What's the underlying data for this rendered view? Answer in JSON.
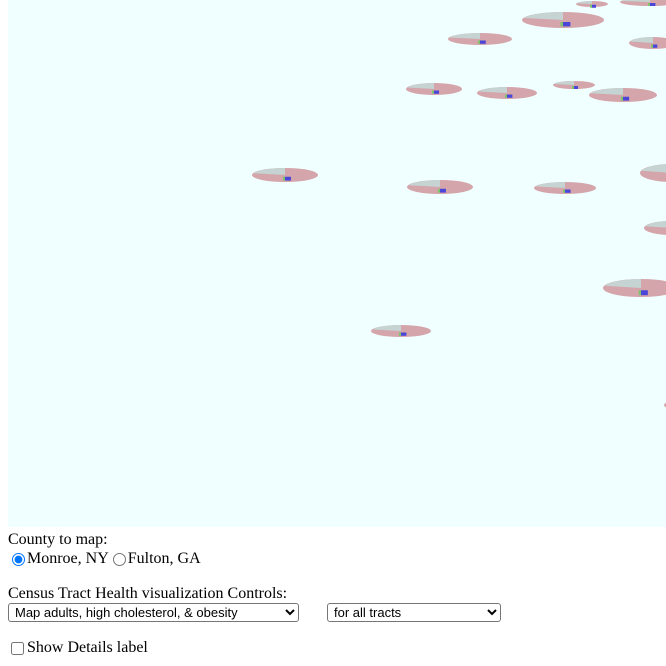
{
  "map": {
    "background": "#f0ffff",
    "glyph_colors": {
      "base": "#d4a5aa",
      "grey": "#c5d3d2",
      "blue": "#4b46d8",
      "green": "#7cc56b"
    },
    "glyph_icon": "pie-glyph"
  },
  "county": {
    "label": "County to map:",
    "options": [
      {
        "label": "Monroe, NY",
        "checked": true
      },
      {
        "label": "Fulton, GA",
        "checked": false
      }
    ]
  },
  "controls": {
    "label": "Census Tract Health visualization Controls:",
    "measure_selected": "Map adults, high cholesterol, & obesity",
    "scope_selected": "for all tracts"
  },
  "details": {
    "label": "Show Details label",
    "checked": false
  }
}
